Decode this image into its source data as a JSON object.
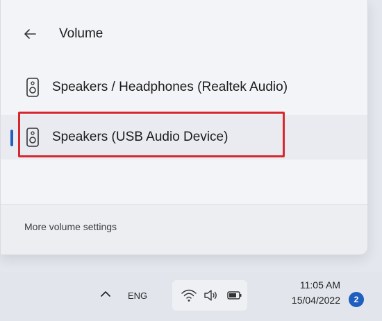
{
  "volume_flyout": {
    "title": "Volume",
    "devices": [
      {
        "label": "Speakers / Headphones (Realtek Audio)",
        "selected": false,
        "icon": "speaker-icon"
      },
      {
        "label": "Speakers (USB Audio Device)",
        "selected": true,
        "icon": "speaker-icon"
      }
    ],
    "footer_link": "More volume settings"
  },
  "taskbar": {
    "language": "ENG",
    "time": "11:05 AM",
    "date": "15/04/2022",
    "notification_count": "2"
  },
  "colors": {
    "accent": "#1f5fbf",
    "highlight": "#d7262c"
  }
}
